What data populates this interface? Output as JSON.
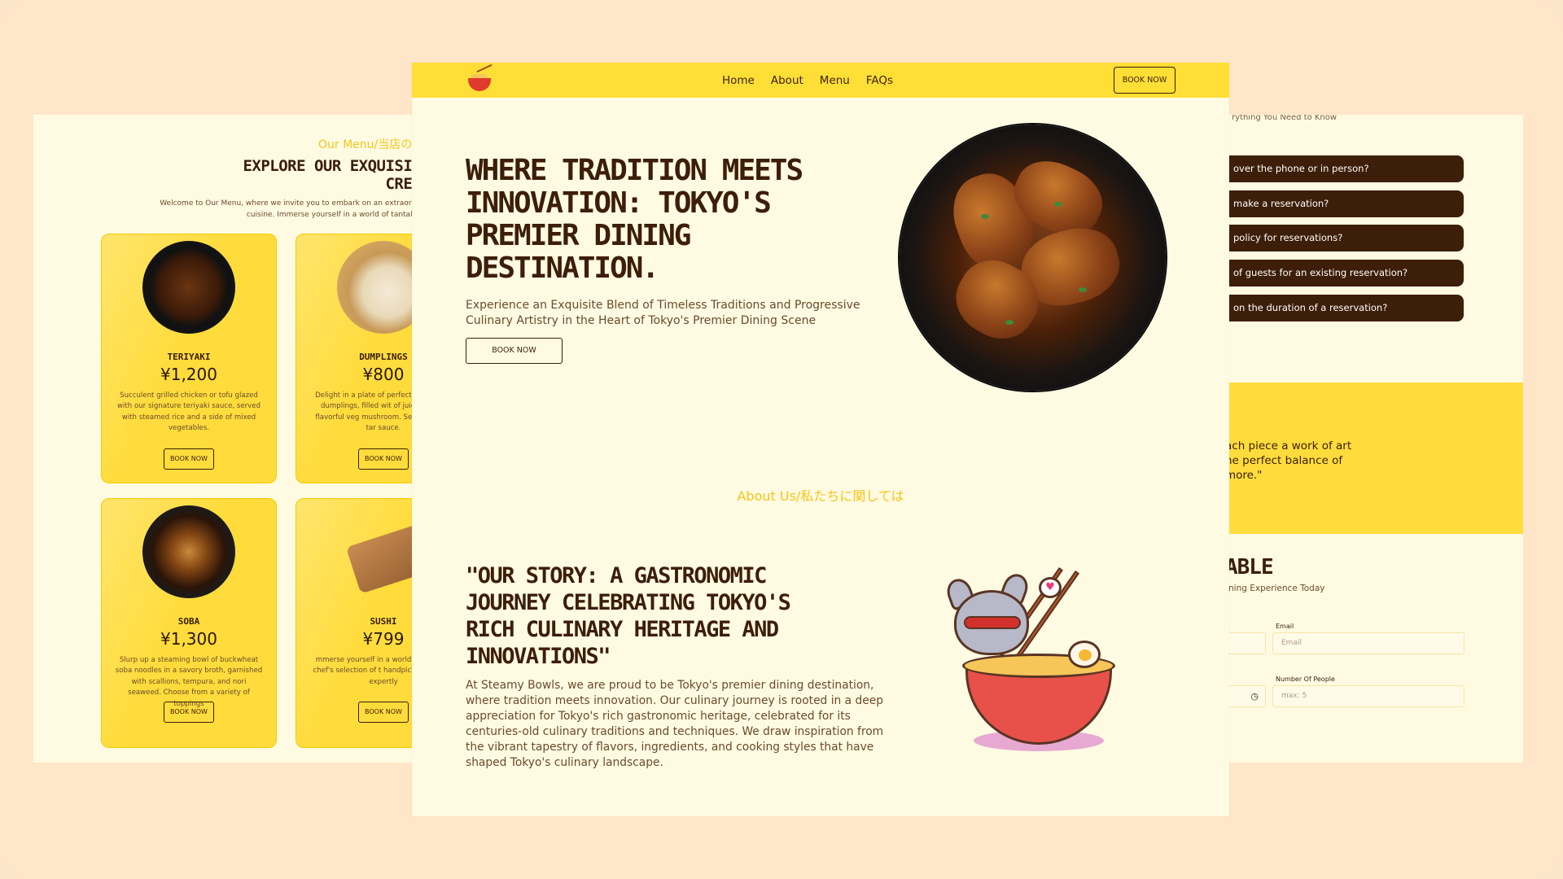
{
  "nav": {
    "links": [
      "Home",
      "About",
      "Menu",
      "FAQs"
    ],
    "book_label": "BOOK NOW"
  },
  "hero": {
    "title": "Where Tradition Meets Innovation: Tokyo's Premier Dining Destination.",
    "subtitle": "Experience an Exquisite Blend of Timeless Traditions and Progressive Culinary Artistry in the Heart of Tokyo's Premier Dining Scene",
    "button": "BOOK NOW"
  },
  "about": {
    "eyebrow": "About Us/私たちに関しては",
    "title": "\"Our Story: A Gastronomic Journey Celebrating Tokyo's Rich Culinary Heritage and Innovations\"",
    "body": "At Steamy Bowls, we are proud to be Tokyo's premier dining destination, where tradition meets innovation. Our culinary journey is rooted in a deep appreciation for Tokyo's rich gastronomic heritage, celebrated for its centuries-old culinary traditions and techniques. We draw inspiration from the vibrant tapestry of flavors, ingredients, and cooking styles that have shaped Tokyo's culinary landscape."
  },
  "menu_page": {
    "eyebrow": "Our Menu/当店のメ",
    "heading": "EXPLORE OUR EXQUISITE JA CREATION",
    "intro": "Welcome to Our Menu, where we invite you to embark on an extraordir Japanese cuisine. Immerse yourself in a world of tantalizing flavors",
    "items": [
      {
        "name": "TERIYAKI",
        "price": "¥1,200",
        "desc": "Succulent grilled chicken or tofu glazed with our signature teriyaki sauce, served with steamed rice and a side of mixed vegetables.",
        "button": "BOOK NOW"
      },
      {
        "name": "DUMPLINGS",
        "price": "¥800",
        "desc": "Delight in a plate of perfectly pan-fried dumplings, filled wit of juicy pork or flavorful veg mushroom. Served with a tar sauce.",
        "button": "BOOK NOW"
      },
      {
        "name": "SOBA",
        "price": "¥1,300",
        "desc": "Slurp up a steaming bowl of buckwheat soba noodles in a savory broth, garnished with scallions, tempura, and nori seaweed. Choose from a variety of toppings",
        "button": "BOOK NOW"
      },
      {
        "name": "SUSHI",
        "price": "¥799",
        "desc": "mmerse yourself in a world of with our chef's selection of t handpicked fish and expertly",
        "button": "BOOK NOW"
      }
    ]
  },
  "faq_page": {
    "subtitle": "rything You Need to Know",
    "questions": [
      "over the phone or in person?",
      "make a reservation?",
      "policy for reservations?",
      "of guests for an existing reservation?",
      "on the duration of a reservation?"
    ],
    "quote": "ach piece a work of art he perfect balance of more.\"",
    "quote_lines": [
      "ach piece a work of art",
      "he perfect balance of",
      "more.\""
    ],
    "table_title": "ABLE",
    "table_sub": "ning Experience Today",
    "email_label": "Email",
    "email_placeholder": "Email",
    "people_label": "Number Of People",
    "people_placeholder": "max: 5"
  }
}
